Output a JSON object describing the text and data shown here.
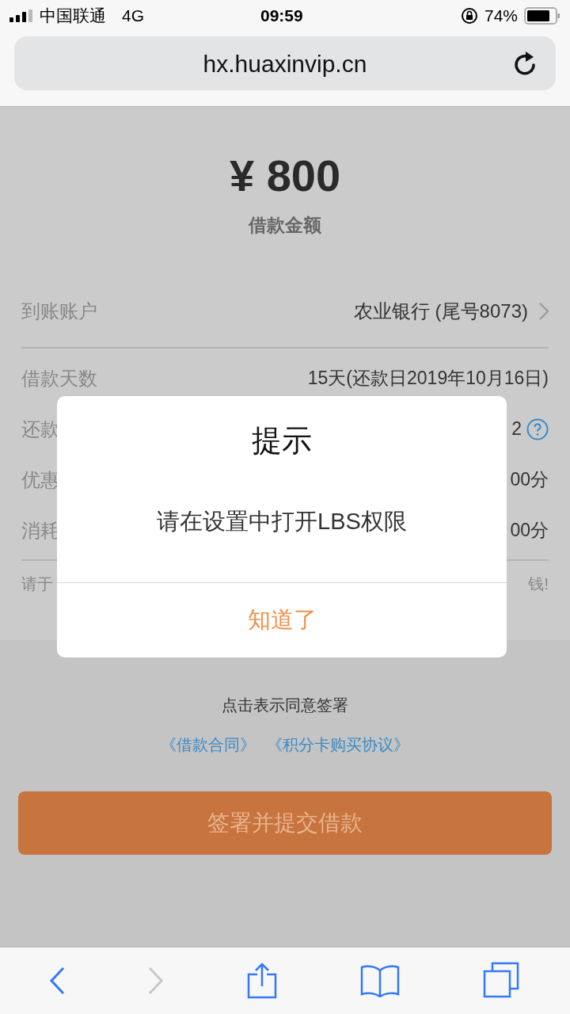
{
  "status_bar": {
    "carrier": "中国联通",
    "network": "4G",
    "time": "09:59",
    "battery": "74%"
  },
  "browser": {
    "url": "hx.huaxinvip.cn"
  },
  "loan": {
    "amount": "¥ 800",
    "amount_label": "借款金额",
    "account": {
      "label": "到账账户",
      "value": "农业银行 (尾号8073)"
    },
    "rows": [
      {
        "label": "借款天数",
        "value": "15天(还款日2019年10月16日)",
        "help": false
      },
      {
        "label": "还款",
        "value": "2",
        "help": true
      },
      {
        "label": "优惠",
        "value": "00分",
        "help": false
      },
      {
        "label": "消耗",
        "value": "00分",
        "help": false
      }
    ],
    "note_left": "请于",
    "note_right": "钱!"
  },
  "agreement": {
    "text": "点击表示同意签署",
    "links": [
      "《借款合同》",
      "《积分卡购买协议》"
    ]
  },
  "submit_button": "签署并提交借款",
  "dialog": {
    "title": "提示",
    "message": "请在设置中打开LBS权限",
    "button": "知道了"
  }
}
